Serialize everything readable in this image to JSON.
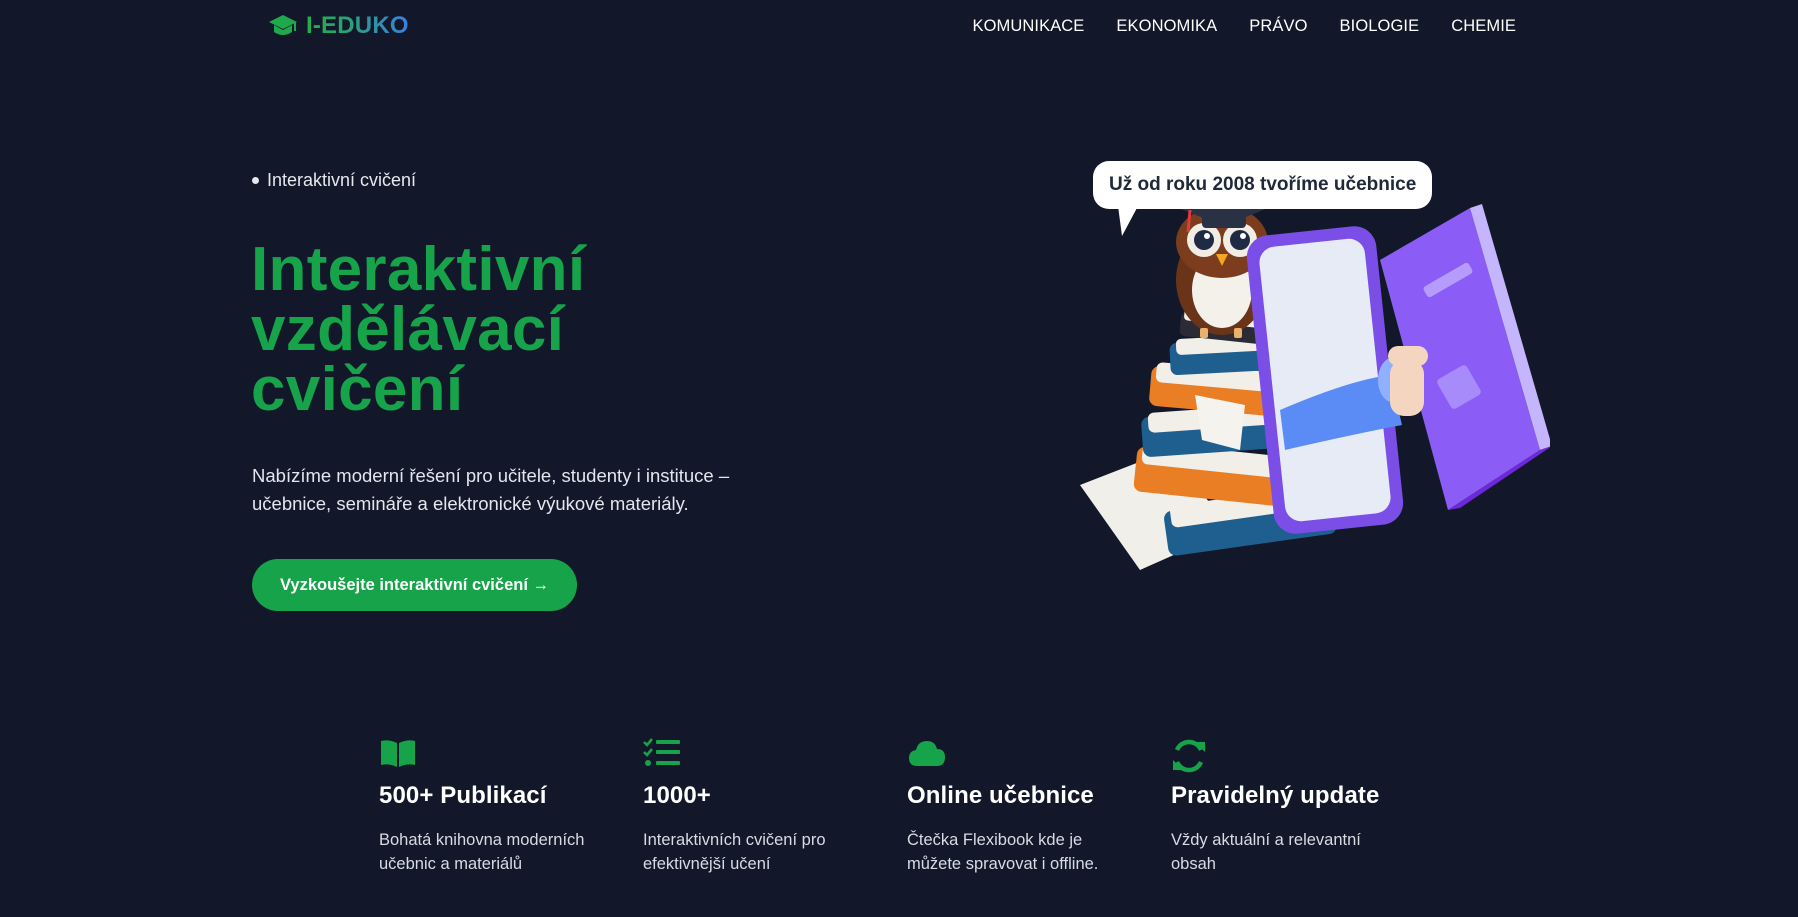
{
  "brand": {
    "logo_text": "I-EDUKO",
    "logo_icon": "graduation-cap-icon"
  },
  "nav": {
    "items": [
      {
        "label": "KOMUNIKACE"
      },
      {
        "label": "EKONOMIKA"
      },
      {
        "label": "PRÁVO"
      },
      {
        "label": "BIOLOGIE"
      },
      {
        "label": "CHEMIE"
      }
    ]
  },
  "hero": {
    "eyebrow": "Interaktivní cvičení",
    "title_line1": "Interaktivní",
    "title_line2": "vzdělávací",
    "title_line3": "cvičení",
    "subtitle_line1": "Nabízíme moderní řešení pro učitele, studenty i instituce –",
    "subtitle_line2": "učebnice, semináře a elektronické výukové materiály.",
    "cta_label": "Vyzkoušejte interaktivní cvičení →"
  },
  "illustration": {
    "speech_bubble": "Už od roku 2008 tvoříme učebnice",
    "alt": "owl-on-books-with-phone-and-book"
  },
  "features": [
    {
      "icon": "open-book-icon",
      "title": "500+ Publikací",
      "text_line1": "Bohatá knihovna moderních",
      "text_line2": "učebnic a materiálů"
    },
    {
      "icon": "checklist-icon",
      "title": "1000+",
      "text_line1": "Interaktivních cvičení pro",
      "text_line2": "efektivnější učení"
    },
    {
      "icon": "cloud-icon",
      "title": "Online učebnice",
      "text_line1": "Čtečka Flexibook kde je",
      "text_line2": "můžete spravovat i offline."
    },
    {
      "icon": "sync-icon",
      "title": "Pravidelný update",
      "text_line1": "Vždy aktuální a relevantní",
      "text_line2": "obsah"
    }
  ],
  "colors": {
    "background": "#121829",
    "accent": "#16a34a",
    "text": "#ffffff",
    "muted_text": "#d7dbe4"
  }
}
